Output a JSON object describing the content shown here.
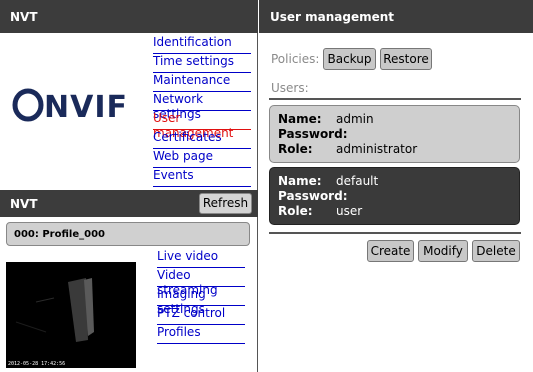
{
  "left": {
    "title": "NVT",
    "logo_text": "ONVIF",
    "nav_items": [
      {
        "label": "Identification",
        "active": false
      },
      {
        "label": "Time settings",
        "active": false
      },
      {
        "label": "Maintenance",
        "active": false
      },
      {
        "label": "Network settings",
        "active": false
      },
      {
        "label": "User management",
        "active": true
      },
      {
        "label": "Certificates",
        "active": false
      },
      {
        "label": "Web page",
        "active": false
      },
      {
        "label": "Events",
        "active": false
      }
    ],
    "section_title": "NVT",
    "refresh_label": "Refresh",
    "profile_label": "000: Profile_000",
    "video_timestamp": "2012-05-28 17:42:56",
    "video_nav_items": [
      "Live video",
      "Video streaming",
      "Imaging settings",
      "PTZ control",
      "Profiles"
    ]
  },
  "right": {
    "title": "User management",
    "policies_label": "Policies:",
    "backup_label": "Backup",
    "restore_label": "Restore",
    "users_label": "Users:",
    "name_key": "Name:",
    "password_key": "Password:",
    "role_key": "Role:",
    "users": [
      {
        "name": "admin",
        "password": "",
        "role": "administrator",
        "selected": false
      },
      {
        "name": "default",
        "password": "",
        "role": "user",
        "selected": true
      }
    ],
    "create_label": "Create",
    "modify_label": "Modify",
    "delete_label": "Delete"
  }
}
